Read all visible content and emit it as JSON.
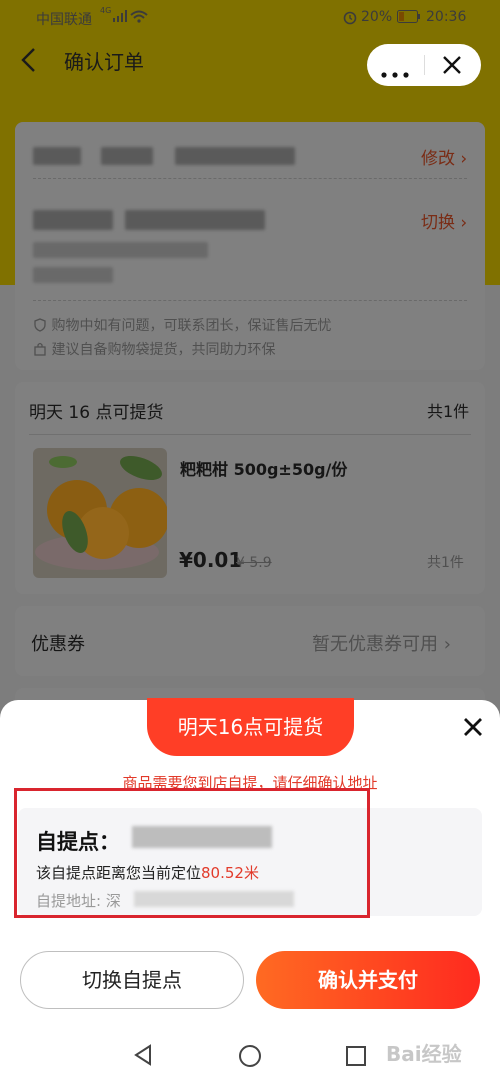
{
  "status_bar": {
    "carrier": "中国联通",
    "network": "4G",
    "battery": "20%",
    "time": "20:36"
  },
  "header": {
    "title": "确认订单"
  },
  "address_card": {
    "modify_label": "修改",
    "switch_label": "切换",
    "tips": [
      "购物中如有问题，可联系团长，保证售后无忧",
      "建议自备购物袋提货，共同助力环保"
    ]
  },
  "order_card": {
    "pickup_time": "明天 16 点可提货",
    "total_count": "共1件",
    "product": {
      "name": "粑粑柑 500g±50g/份",
      "price": "¥0.01",
      "original_price": "¥ 5.9",
      "quantity": "共1件"
    }
  },
  "coupon": {
    "label": "优惠券",
    "value": "暂无优惠券可用"
  },
  "sheet": {
    "ribbon": "明天16点可提货",
    "notice": "商品需要您到店自提，请仔细确认地址",
    "pickup_label": "自提点：",
    "distance_prefix": "该自提点距离您当前定位",
    "distance_value": "80.52米",
    "address_label": "自提地址: 深",
    "switch_button": "切换自提点",
    "pay_button": "确认并支付"
  },
  "watermark": "Bai经验",
  "colors": {
    "accent": "#ff3e26",
    "notice": "#e23a2a",
    "highlight_box": "#d9252e"
  }
}
